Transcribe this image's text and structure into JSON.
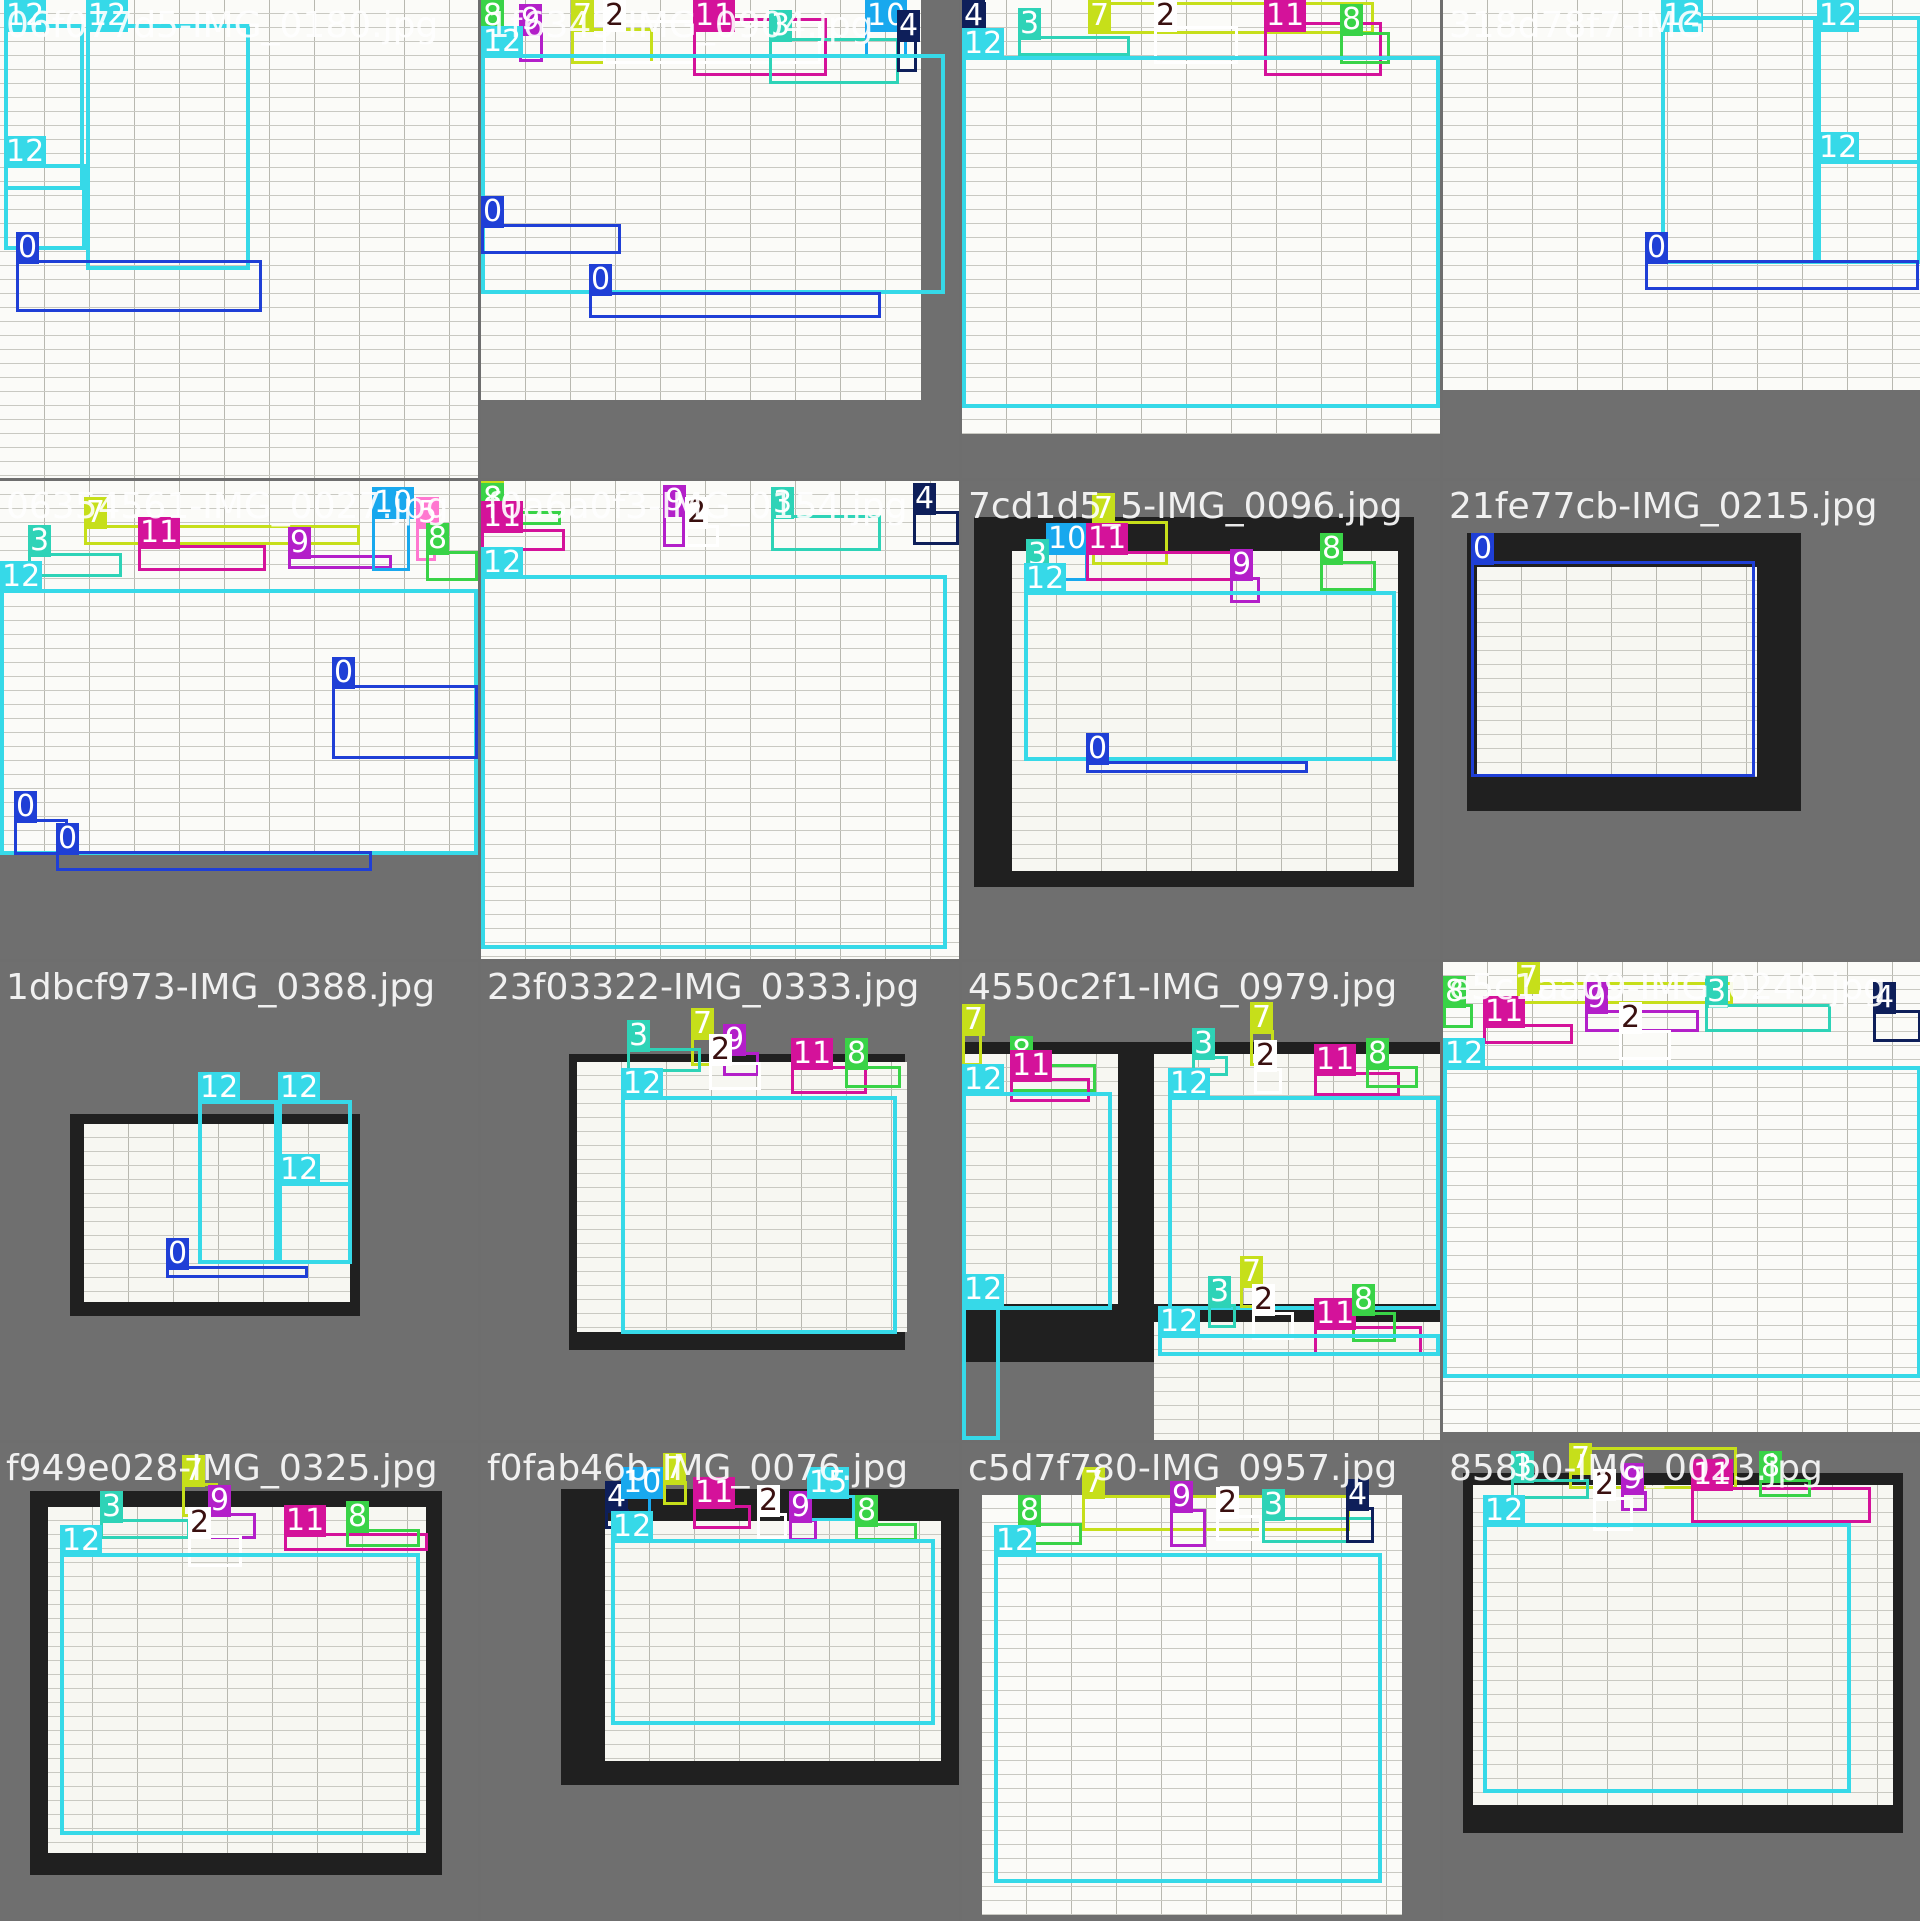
{
  "tiles": [
    {
      "title": "06f077d5-IMG_0180.jpg"
    },
    {
      "title": "1f6343-IMG_0904.jpg"
    },
    {
      "title": ""
    },
    {
      "title": "318d78f7-IMG"
    },
    {
      "title": "06354561-IMG_0027.jpg"
    },
    {
      "title": "f0a6a0f3-IMG_0154.jpg"
    },
    {
      "title": "7cd1d5_5-IMG_0096.jpg"
    },
    {
      "title": "21fe77cb-IMG_0215.jpg"
    },
    {
      "title": "1dbcf973-IMG_0388.jpg"
    },
    {
      "title": "23f03322-IMG_0333.jpg"
    },
    {
      "title": "4550c2f1-IMG_0979.jpg"
    },
    {
      "title": "e5c1aa09-IMG_0249.jpg"
    },
    {
      "title": "f949e028-IMG_0325.jpg"
    },
    {
      "title": "f0fab46b-IMG_0076.jpg"
    },
    {
      "title": "c5d7f780-IMG_0957.jpg"
    },
    {
      "title": "858b0-IMG_0023.jpg"
    }
  ],
  "class_colors": {
    "0": "#1f3fd6",
    "2": "#ffffff",
    "3": "#2ed3b7",
    "4": "#0e1f5a",
    "5": "#ff77d0",
    "7": "#c6df1a",
    "8": "#39d347",
    "9": "#b31fc9",
    "10": "#18a8ee",
    "11": "#d4129a",
    "12": "#36d9e8"
  },
  "tile_boxes": [
    [
      [
        "12",
        4,
        24,
        84,
        190
      ],
      [
        "12",
        86,
        24,
        250,
        270
      ],
      [
        "12",
        4,
        164,
        86,
        250
      ],
      [
        "0",
        16,
        260,
        262,
        312
      ]
    ],
    [
      [
        "8",
        0,
        14,
        20,
        54
      ],
      [
        "9",
        38,
        32,
        62,
        62
      ],
      [
        "7",
        90,
        28,
        172,
        64
      ],
      [
        "2",
        122,
        20,
        340,
        64
      ],
      [
        "11",
        212,
        18,
        346,
        76
      ],
      [
        "3",
        288,
        38,
        418,
        84
      ],
      [
        "10",
        384,
        18,
        426,
        58
      ],
      [
        "4",
        416,
        38,
        436,
        72
      ],
      [
        "12",
        0,
        54,
        464,
        294
      ],
      [
        "0",
        0,
        224,
        140,
        254
      ],
      [
        "0",
        108,
        292,
        400,
        318
      ]
    ],
    [
      [
        "4",
        0,
        2,
        24,
        50
      ],
      [
        "3",
        56,
        36,
        168,
        56
      ],
      [
        "7",
        126,
        2,
        412,
        34
      ],
      [
        "2",
        192,
        26,
        276,
        64
      ],
      [
        "11",
        302,
        22,
        420,
        76
      ],
      [
        "8",
        378,
        32,
        428,
        64
      ],
      [
        "12",
        0,
        56,
        478,
        408
      ]
    ],
    [
      [
        "12",
        218,
        16,
        374,
        264
      ],
      [
        "12",
        374,
        16,
        478,
        264
      ],
      [
        "12",
        374,
        160,
        478,
        264
      ],
      [
        "0",
        202,
        260,
        476,
        290
      ]
    ],
    [
      [
        "7",
        84,
        44,
        360,
        64
      ],
      [
        "11",
        138,
        64,
        266,
        90
      ],
      [
        "9",
        288,
        74,
        392,
        88
      ],
      [
        "10",
        372,
        34,
        410,
        90
      ],
      [
        "5",
        416,
        44,
        436,
        80
      ],
      [
        "8",
        426,
        70,
        478,
        100
      ],
      [
        "3",
        28,
        72,
        122,
        96
      ],
      [
        "12",
        0,
        108,
        478,
        374
      ],
      [
        "0",
        332,
        204,
        478,
        278
      ],
      [
        "0",
        14,
        338,
        68,
        374
      ],
      [
        "0",
        56,
        370,
        372,
        390
      ]
    ],
    [
      [
        "7",
        0,
        0,
        18,
        40
      ],
      [
        "8",
        0,
        30,
        80,
        44
      ],
      [
        "11",
        0,
        48,
        84,
        70
      ],
      [
        "9",
        182,
        32,
        204,
        66
      ],
      [
        "2",
        204,
        44,
        238,
        66
      ],
      [
        "3",
        290,
        34,
        400,
        70
      ],
      [
        "4",
        432,
        30,
        478,
        64
      ],
      [
        "12",
        0,
        94,
        466,
        468
      ]
    ],
    [
      [
        "7",
        130,
        40,
        206,
        84
      ],
      [
        "10",
        84,
        70,
        126,
        100
      ],
      [
        "11",
        124,
        70,
        288,
        100
      ],
      [
        "9",
        268,
        96,
        298,
        122
      ],
      [
        "8",
        358,
        80,
        414,
        110
      ],
      [
        "3",
        64,
        86,
        90,
        104
      ],
      [
        "12",
        62,
        110,
        434,
        280
      ],
      [
        "0",
        124,
        280,
        346,
        292
      ]
    ],
    [
      [
        "0",
        28,
        80,
        312,
        296
      ]
    ],
    [
      [
        "12",
        198,
        138,
        278,
        302
      ],
      [
        "12",
        278,
        138,
        352,
        302
      ],
      [
        "12",
        278,
        220,
        352,
        302
      ],
      [
        "0",
        166,
        304,
        308,
        316
      ]
    ],
    [
      [
        "7",
        210,
        74,
        232,
        104
      ],
      [
        "3",
        146,
        86,
        220,
        110
      ],
      [
        "9",
        242,
        90,
        278,
        114
      ],
      [
        "2",
        228,
        100,
        280,
        128
      ],
      [
        "11",
        310,
        104,
        386,
        132
      ],
      [
        "8",
        364,
        104,
        420,
        126
      ],
      [
        "12",
        140,
        134,
        416,
        372
      ]
    ],
    [
      [
        "7",
        0,
        70,
        20,
        104
      ],
      [
        "8",
        48,
        102,
        134,
        130
      ],
      [
        "11",
        48,
        116,
        128,
        140
      ],
      [
        "12",
        0,
        130,
        150,
        348
      ],
      [
        "7",
        288,
        68,
        312,
        104
      ],
      [
        "3",
        230,
        94,
        266,
        114
      ],
      [
        "2",
        292,
        106,
        320,
        132
      ],
      [
        "11",
        352,
        110,
        438,
        134
      ],
      [
        "8",
        404,
        104,
        456,
        126
      ],
      [
        "12",
        206,
        134,
        478,
        348
      ],
      [
        "12",
        0,
        340,
        38,
        478
      ],
      [
        "7",
        278,
        322,
        304,
        346
      ],
      [
        "3",
        246,
        342,
        274,
        366
      ],
      [
        "2",
        290,
        350,
        332,
        378
      ],
      [
        "11",
        352,
        364,
        460,
        394
      ],
      [
        "8",
        390,
        350,
        434,
        380
      ],
      [
        "12",
        196,
        372,
        478,
        394
      ]
    ],
    [
      [
        "7",
        74,
        20,
        290,
        42
      ],
      [
        "8",
        0,
        42,
        30,
        66
      ],
      [
        "11",
        40,
        62,
        130,
        82
      ],
      [
        "9",
        142,
        48,
        256,
        70
      ],
      [
        "2",
        176,
        68,
        228,
        98
      ],
      [
        "3",
        262,
        42,
        388,
        70
      ],
      [
        "4",
        430,
        48,
        478,
        80
      ],
      [
        "12",
        0,
        104,
        478,
        416
      ]
    ],
    [
      [
        "7",
        182,
        40,
        218,
        74
      ],
      [
        "3",
        100,
        76,
        190,
        96
      ],
      [
        "9",
        208,
        70,
        256,
        96
      ],
      [
        "2",
        188,
        92,
        242,
        124
      ],
      [
        "11",
        284,
        90,
        428,
        108
      ],
      [
        "8",
        346,
        86,
        420,
        104
      ],
      [
        "12",
        60,
        110,
        420,
        392
      ]
    ],
    [
      [
        "7",
        182,
        38,
        206,
        62
      ],
      [
        "4",
        124,
        66,
        148,
        86
      ],
      [
        "10",
        140,
        52,
        170,
        80
      ],
      [
        "11",
        212,
        62,
        270,
        86
      ],
      [
        "2",
        276,
        70,
        306,
        96
      ],
      [
        "9",
        308,
        76,
        336,
        98
      ],
      [
        "15",
        326,
        52,
        374,
        78
      ],
      [
        "8",
        374,
        80,
        436,
        98
      ],
      [
        "12",
        130,
        96,
        454,
        282
      ]
    ],
    [
      [
        "7",
        120,
        52,
        388,
        88
      ],
      [
        "9",
        208,
        66,
        244,
        104
      ],
      [
        "2",
        254,
        72,
        300,
        98
      ],
      [
        "3",
        300,
        74,
        412,
        100
      ],
      [
        "4",
        384,
        64,
        412,
        100
      ],
      [
        "8",
        56,
        80,
        120,
        102
      ],
      [
        "12",
        32,
        110,
        420,
        440
      ]
    ],
    [
      [
        "7",
        126,
        4,
        294,
        46
      ],
      [
        "3",
        68,
        36,
        146,
        56
      ],
      [
        "9",
        178,
        48,
        204,
        68
      ],
      [
        "2",
        150,
        54,
        190,
        88
      ],
      [
        "11",
        248,
        44,
        428,
        80
      ],
      [
        "8",
        316,
        36,
        368,
        54
      ],
      [
        "12",
        40,
        80,
        408,
        350
      ]
    ]
  ]
}
